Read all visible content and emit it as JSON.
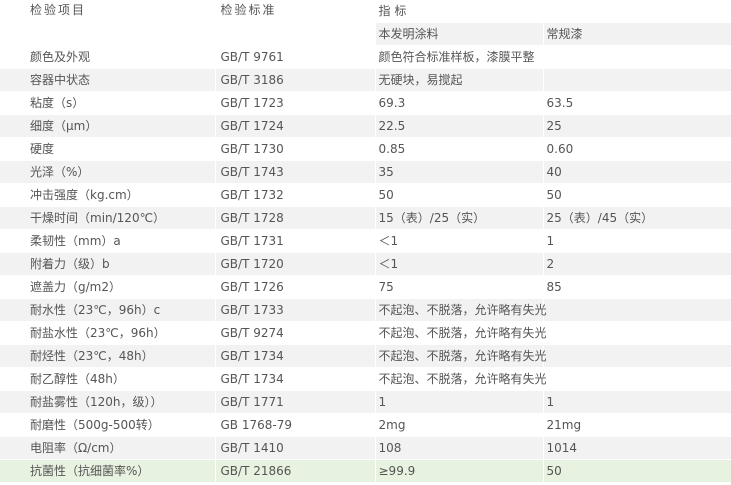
{
  "header": {
    "col1": "检验项目",
    "col2": "检验标准",
    "col3": "指 标",
    "sub1": "本发明涂料",
    "sub2": "常规漆"
  },
  "rows": [
    {
      "item": "颜色及外观",
      "std": "GB/T 9761",
      "val1": "颜色符合标准样板，漆膜平整",
      "val2": ""
    },
    {
      "item": "容器中状态",
      "std": "GB/T 3186",
      "val1": "无硬块，易搅起",
      "val2": ""
    },
    {
      "item": "粘度（s）",
      "std": "GB/T 1723",
      "val1": "69.3",
      "val2": "63.5"
    },
    {
      "item": "细度（μm）",
      "std": "GB/T 1724",
      "val1": "22.5",
      "val2": "25"
    },
    {
      "item": "硬度",
      "std": "GB/T 1730",
      "val1": "0.85",
      "val2": "0.60"
    },
    {
      "item": "光泽（%）",
      "std": "GB/T 1743",
      "val1": "35",
      "val2": "40"
    },
    {
      "item": "冲击强度（kg.cm）",
      "std": "GB/T 1732",
      "val1": "50",
      "val2": "50"
    },
    {
      "item": "干燥时间（min/120℃）",
      "std": "GB/T 1728",
      "val1": "15（表）/25（实）",
      "val2": "25（表）/45（实）"
    },
    {
      "item": "柔韧性（mm）a",
      "std": "GB/T 1731",
      "val1": "＜1",
      "val2": "1"
    },
    {
      "item": "附着力（级）b",
      "std": "GB/T 1720",
      "val1": "＜1",
      "val2": "2"
    },
    {
      "item": "遮盖力（g/m2）",
      "std": "GB/T 1726",
      "val1": "75",
      "val2": "85"
    },
    {
      "item": "耐水性（23℃，96h）c",
      "std": "GB/T 1733",
      "val1": "不起泡、不脱落，允许略有失光",
      "val2": ""
    },
    {
      "item": "耐盐水性（23℃，96h）",
      "std": "GB/T 9274",
      "val1": "不起泡、不脱落，允许略有失光",
      "val2": ""
    },
    {
      "item": "耐烃性（23℃，48h）",
      "std": "GB/T 1734",
      "val1": "不起泡、不脱落，允许略有失光",
      "val2": ""
    },
    {
      "item": "耐乙醇性（48h）",
      "std": "GB/T 1734",
      "val1": "不起泡、不脱落，允许略有失光",
      "val2": ""
    },
    {
      "item": "耐盐雾性（120h，级））",
      "std": "GB/T 1771",
      "val1": "1",
      "val2": "1"
    },
    {
      "item": "耐磨性（500g-500转）",
      "std": "GB 1768-79",
      "val1": "2mg",
      "val2": "21mg"
    },
    {
      "item": "电阻率（Ω/cm）",
      "std": "GB/T 1410",
      "val1": "108",
      "val2": "1014"
    },
    {
      "item": "抗菌性（抗细菌率%）",
      "std": "GB/T 21866",
      "val1": "≥99.9",
      "val2": "50"
    }
  ],
  "colors": {
    "row_grey": "#f2f2f2",
    "row_white": "#ffffff",
    "row_highlight": "#e8f2e0",
    "text": "#555555"
  }
}
